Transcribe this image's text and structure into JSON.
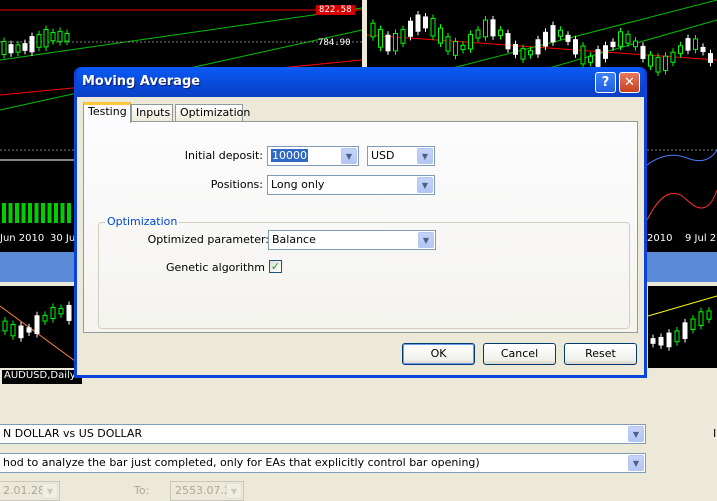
{
  "background": {
    "chart_tl": {
      "price_tag": "822.58",
      "price_label": "784.90",
      "dates": [
        "Jun 2010",
        "30 Jul"
      ]
    },
    "chart_tr": {
      "dates": [
        "2010",
        "9 Jul 2"
      ]
    },
    "chart_bl": {
      "caption": "AUDUSD,Daily"
    }
  },
  "tester": {
    "symbol": "N DOLLAR vs US DOLLAR",
    "model": "hod to analyze the bar just completed, only for EAs that explicitly control bar opening)",
    "from_date": "2.01.28",
    "to_label": "To:",
    "to_date": "2553.07.27"
  },
  "dialog": {
    "title": "Moving Average",
    "help_glyph": "?",
    "close_glyph": "✕",
    "tabs": [
      "Testing",
      "Inputs",
      "Optimization"
    ],
    "initial_deposit_label": "Initial deposit:",
    "initial_deposit_value": "10000",
    "currency_value": "USD",
    "positions_label": "Positions:",
    "positions_value": "Long only",
    "optimization_group": "Optimization",
    "optimized_param_label": "Optimized parameter:",
    "optimized_param_value": "Balance",
    "genetic_label": "Genetic algorithm",
    "genetic_checked": "✓",
    "ok_label": "OK",
    "cancel_label": "Cancel",
    "reset_label": "Reset"
  },
  "icons": {
    "combo_arrow": "▼"
  },
  "colors": {
    "accent": "#0a43d8",
    "chart_bg": "#000000",
    "bull": "#00ff00",
    "bear": "#ffffff",
    "ma_red": "#ff0000"
  }
}
